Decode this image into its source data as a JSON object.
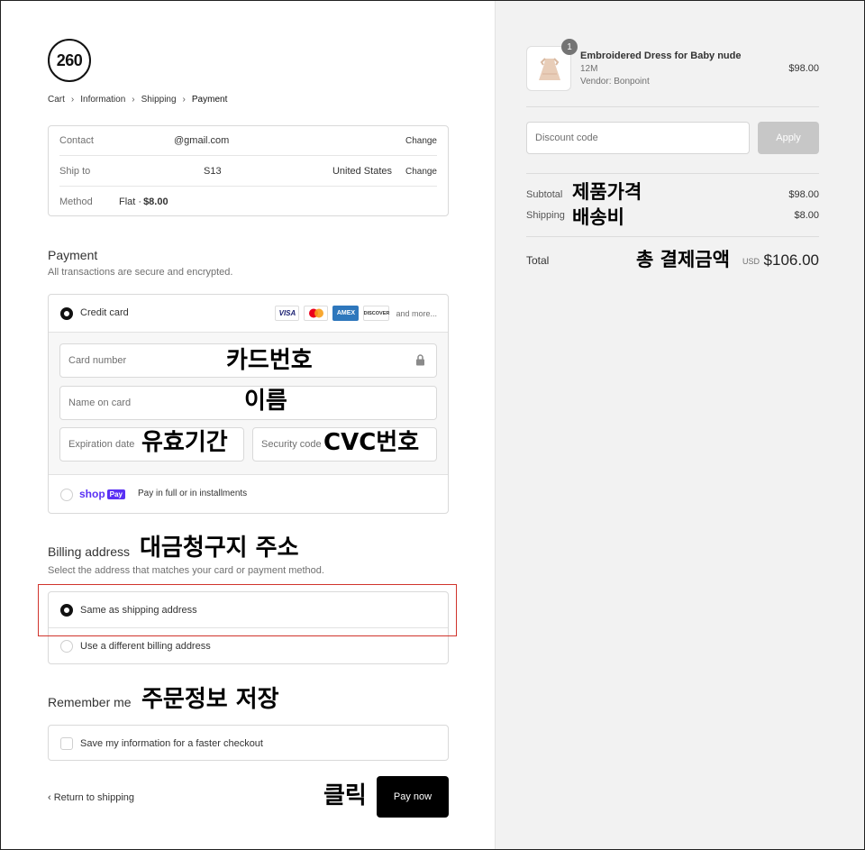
{
  "brand": {
    "logo_text": "260"
  },
  "breadcrumb": {
    "items": [
      "Cart",
      "Information",
      "Shipping",
      "Payment"
    ]
  },
  "summary": {
    "contact_label": "Contact",
    "contact_value": "@gmail.com",
    "contact_change": "Change",
    "shipto_label": "Ship to",
    "shipto_value": "S13",
    "shipto_country": "United States",
    "shipto_change": "Change",
    "method_label": "Method",
    "method_value": "Flat · ",
    "method_price": "$8.00"
  },
  "payment": {
    "title": "Payment",
    "subtitle": "All transactions are secure and encrypted.",
    "credit_label": "Credit card",
    "card_brands": [
      "VISA",
      "",
      "AMEX",
      "DISCOVER"
    ],
    "and_more": "and more...",
    "card_number_placeholder": "Card number",
    "name_placeholder": "Name on card",
    "expiry_placeholder": "Expiration date",
    "security_placeholder": "Security code",
    "shoppay_shop": "shop",
    "shoppay_pay": "Pay",
    "shoppay_label": "Pay in full or in installments"
  },
  "billing": {
    "title": "Billing address",
    "subtitle": "Select the address that matches your card or payment method.",
    "same_label": "Same as shipping address",
    "different_label": "Use a different billing address"
  },
  "remember": {
    "title": "Remember me",
    "save_label": "Save my information for a faster checkout"
  },
  "actions": {
    "return_link": "Return to shipping",
    "pay_now": "Pay now"
  },
  "annotations": {
    "card_number": "카드번호",
    "name": "이름",
    "expiry": "유효기간",
    "cvc": "CVC번호",
    "billing": "대금청구지 주소",
    "remember": "주문정보 저장",
    "click": "클릭",
    "subtotal": "제품가격",
    "shipping": "배송비",
    "total": "총 결제금액"
  },
  "order": {
    "qty": "1",
    "product_name": "Embroidered Dress for Baby nude",
    "variant": "12M",
    "vendor": "Vendor: Bonpoint",
    "price": "$98.00",
    "discount_placeholder": "Discount code",
    "apply": "Apply",
    "subtotal_label": "Subtotal",
    "subtotal_value": "$98.00",
    "shipping_label": "Shipping",
    "shipping_value": "$8.00",
    "total_label": "Total",
    "currency": "USD",
    "total_value": "$106.00"
  }
}
